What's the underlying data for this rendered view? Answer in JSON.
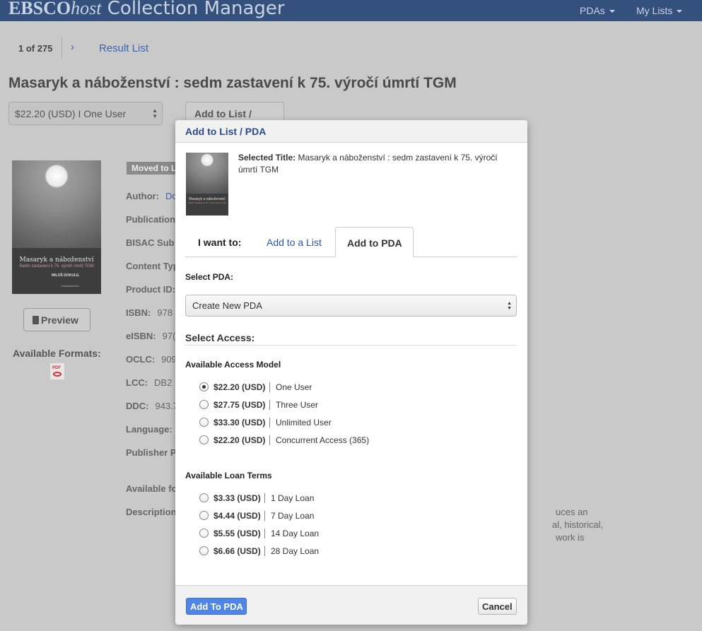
{
  "header": {
    "brand_ebsco": "EBSCO",
    "brand_host": "host",
    "brand_rest": " Collection Manager",
    "nav": [
      {
        "label": "PDAs"
      },
      {
        "label": "My Lists"
      }
    ]
  },
  "pager": {
    "count": "1 of 275",
    "next": "›",
    "result_list": "Result List"
  },
  "record": {
    "title": "Masaryk a náboženství : sedm zastavení k 75. výročí úmrtí TGM",
    "price_select": "$22.20 (USD) I One User",
    "add_button": "Add to List / PDA",
    "preview_button": "Preview",
    "available_formats": "Available Formats:",
    "format_icon": "PDF",
    "cover": {
      "title": "Masaryk a náboženství",
      "subtitle": "Sedm zastavení k 75. výročí úmrtí TGM",
      "author": "MILOŠ DOKULIL",
      "publisher": "Nakladatelství"
    },
    "moved_badge": "Moved to L",
    "meta": [
      {
        "label": "Author:",
        "value": "Do"
      },
      {
        "label": "Publication",
        "value": ""
      },
      {
        "label": "BISAC Sub",
        "value": ""
      },
      {
        "label": "Content Typ",
        "value": ""
      },
      {
        "label": "Product ID:",
        "value": ""
      },
      {
        "label": "ISBN:",
        "value": "978"
      },
      {
        "label": "eISBN:",
        "value": "97("
      },
      {
        "label": "OCLC:",
        "value": "909"
      },
      {
        "label": "LCC:",
        "value": "DB2"
      },
      {
        "label": "DDC:",
        "value": "943.7"
      },
      {
        "label": "Language:",
        "value": ""
      },
      {
        "label": "Publisher P",
        "value": ""
      },
      {
        "label": "Available fo",
        "value": ""
      },
      {
        "label": "Description",
        "value": ""
      }
    ],
    "description_fragments": [
      "uces an",
      "al, historical,",
      "work is"
    ]
  },
  "modal": {
    "title": "Add to List / PDA",
    "selected_label": "Selected Title:",
    "selected_value": "Masaryk a náboženství : sedm zastavení k 75. výročí úmrtí TGM",
    "thumb": {
      "title": "Masaryk a náboženství",
      "subtitle": "Sedm zastavení k 75. výročí úmrtí TGM"
    },
    "tabs": {
      "prefix": "I want to:",
      "add_list": "Add to a List",
      "add_pda": "Add to PDA",
      "active": "Add to PDA"
    },
    "select_pda_label": "Select PDA:",
    "select_pda_value": "Create New PDA",
    "select_access": "Select Access:",
    "access_model_header": "Available Access Model",
    "access_models": [
      {
        "price": "$22.20 (USD)",
        "name": "One User",
        "selected": true
      },
      {
        "price": "$27.75 (USD)",
        "name": "Three User",
        "selected": false
      },
      {
        "price": "$33.30 (USD)",
        "name": "Unlimited User",
        "selected": false
      },
      {
        "price": "$22.20 (USD)",
        "name": "Concurrent Access (365)",
        "selected": false
      }
    ],
    "loan_terms_header": "Available Loan Terms",
    "loan_terms": [
      {
        "price": "$3.33 (USD)",
        "name": "1 Day Loan",
        "selected": false
      },
      {
        "price": "$4.44 (USD)",
        "name": "7 Day Loan",
        "selected": false
      },
      {
        "price": "$5.55 (USD)",
        "name": "14 Day Loan",
        "selected": false
      },
      {
        "price": "$6.66 (USD)",
        "name": "28 Day Loan",
        "selected": false
      }
    ],
    "add_button": "Add To PDA",
    "cancel_button": "Cancel"
  },
  "colors": {
    "header_bar": "#34517e",
    "link": "#2a55b0",
    "primary_button": "#4f86e6",
    "overlay": "#c9c9c9"
  }
}
